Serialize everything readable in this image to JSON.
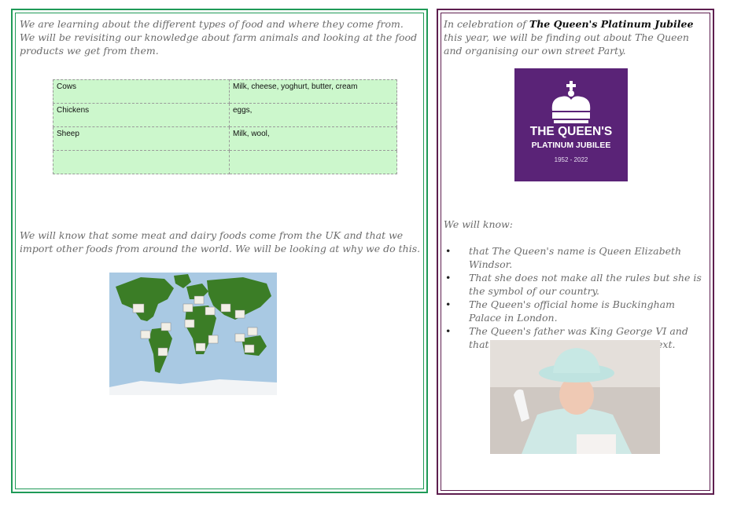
{
  "left": {
    "intro_text": "We are learning about the different types of food and where they come from.  We will be revisiting our knowledge about farm animals and looking at the food products we get from them.",
    "table": [
      [
        "Cows",
        "Milk, cheese, yoghurt, butter, cream"
      ],
      [
        "Chickens",
        "eggs,"
      ],
      [
        "Sheep",
        "Milk, wool,"
      ],
      [
        "",
        ""
      ]
    ],
    "meat_text": "We will know that some meat and dairy foods come from the UK and that we import other foods from around the world.  We will be looking at why we do this."
  },
  "right": {
    "celebration_prefix": "In celebration of ",
    "celebration_bold": "The Queen's Platinum Jubilee",
    "celebration_suffix": " this year, we will be finding out about The Queen and organising our own street Party.",
    "logo": {
      "line1": "THE QUEEN'S",
      "line2": "PLATINUM JUBILEE",
      "years": "1952  -  2022",
      "bg_color": "#5a2377"
    },
    "we_will_know": "We will know:",
    "know_items": [
      "that The Queen's name is Queen Elizabeth Windsor.",
      "That she does not make all the rules but she is the symbol of our country.",
      "The Queen's official home is Buckingham Palace in London.",
      "The Queen's father was King George VI and that there will be a King of England next."
    ]
  },
  "colors": {
    "left_border": "#1f9a57",
    "right_border": "#5e1e4f",
    "table_bg": "#ccf7cc"
  }
}
